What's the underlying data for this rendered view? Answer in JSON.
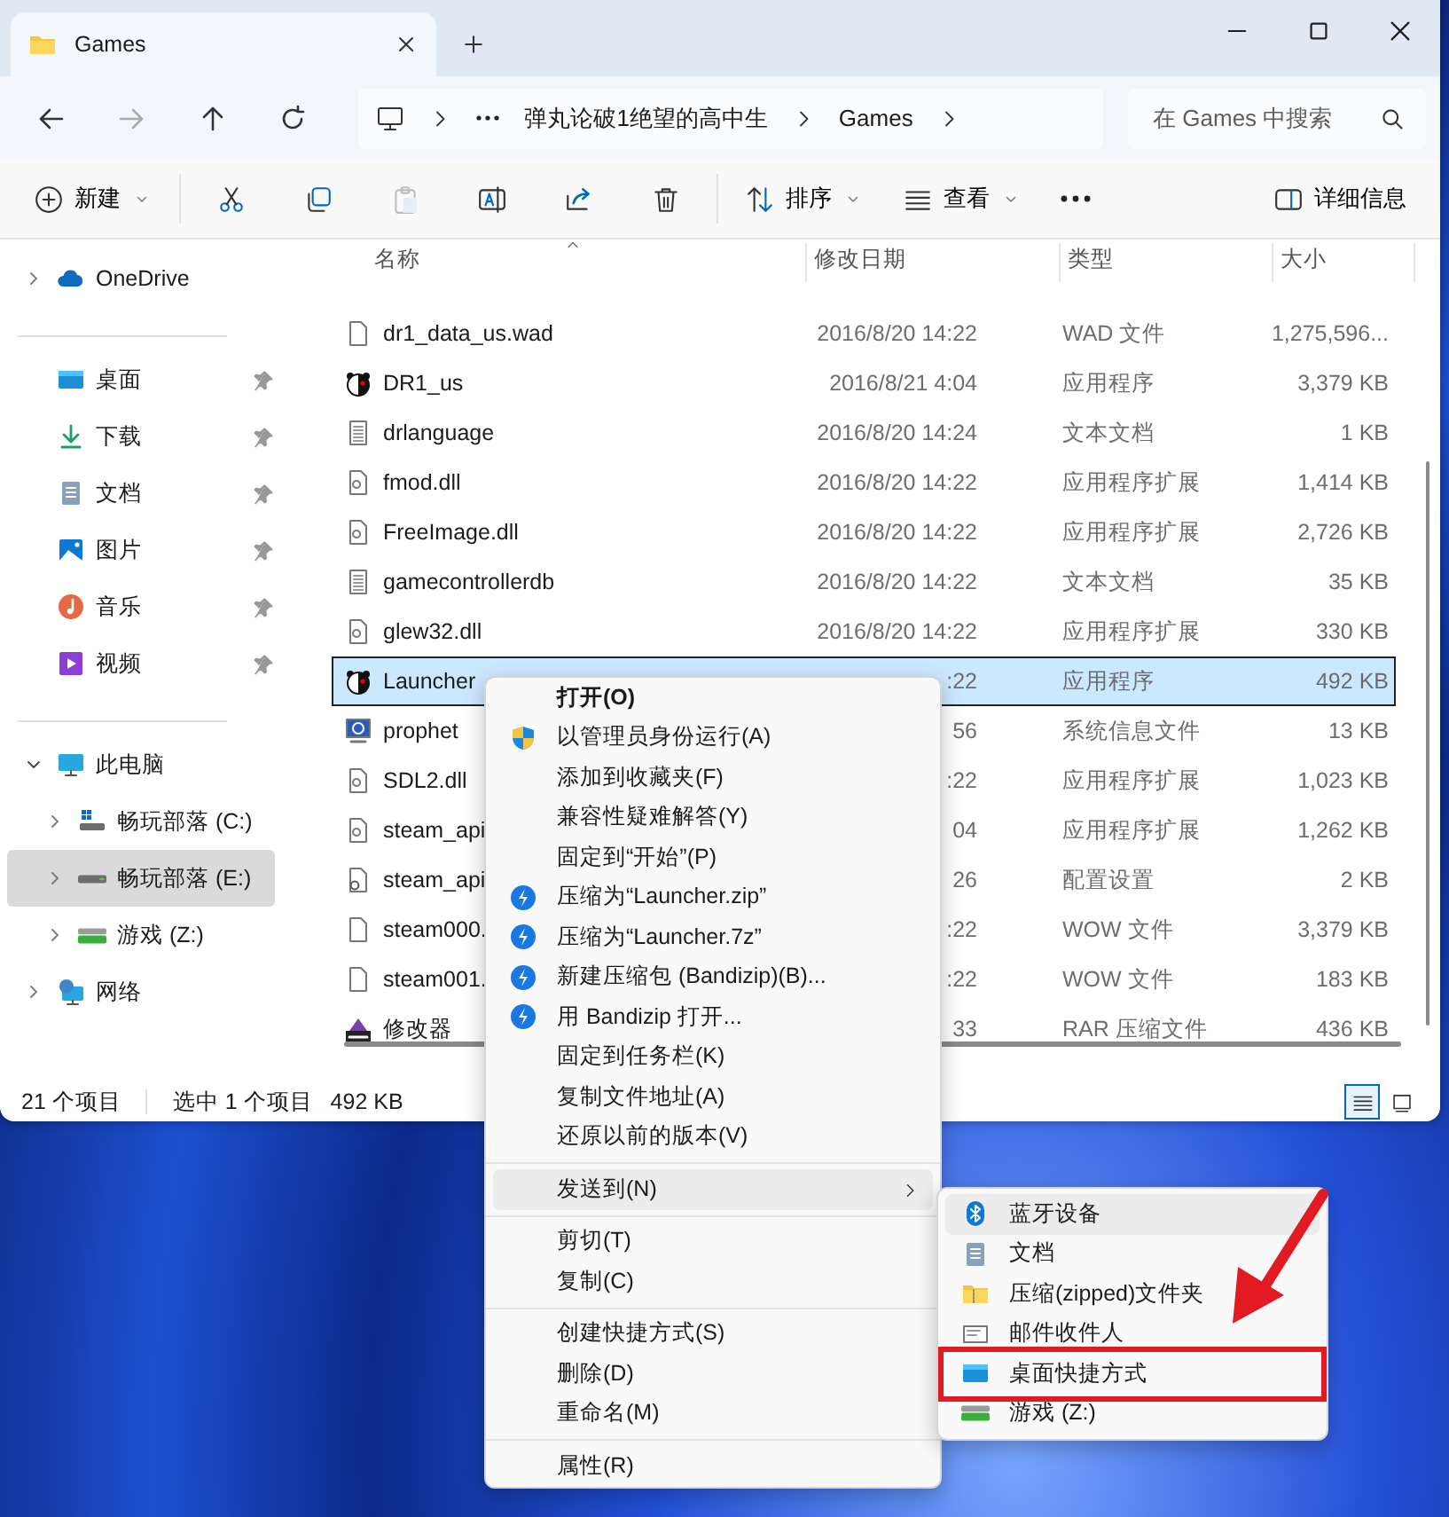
{
  "window": {
    "tab_title": "Games"
  },
  "address": {
    "path": [
      "弹丸论破1绝望的高中生",
      "Games"
    ],
    "search_placeholder": "在 Games 中搜索"
  },
  "toolbar": [
    {
      "kind": "new",
      "label": "新建",
      "disabled": false
    },
    {
      "kind": "cut",
      "disabled": false
    },
    {
      "kind": "copy",
      "disabled": false
    },
    {
      "kind": "paste",
      "disabled": true
    },
    {
      "kind": "rename",
      "disabled": false
    },
    {
      "kind": "share",
      "disabled": false
    },
    {
      "kind": "delete",
      "disabled": false
    },
    {
      "kind": "sort",
      "label": "排序",
      "disabled": false
    },
    {
      "kind": "view",
      "label": "查看",
      "disabled": false
    },
    {
      "kind": "more",
      "disabled": false
    },
    {
      "kind": "details",
      "label": "详细信息",
      "disabled": false
    }
  ],
  "sidebar": {
    "sections": [
      [
        {
          "kind": "cloud",
          "label": "OneDrive",
          "expanded": false,
          "selected": false
        }
      ],
      [
        {
          "kind": "desktop",
          "label": "桌面",
          "pinned": true,
          "selected": false
        },
        {
          "kind": "downloads",
          "label": "下载",
          "pinned": true,
          "selected": false
        },
        {
          "kind": "documents",
          "label": "文档",
          "pinned": true,
          "selected": false
        },
        {
          "kind": "pictures",
          "label": "图片",
          "pinned": true,
          "selected": false
        },
        {
          "kind": "music",
          "label": "音乐",
          "pinned": true,
          "selected": false
        },
        {
          "kind": "videos",
          "label": "视频",
          "pinned": true,
          "selected": false
        }
      ],
      [
        {
          "kind": "computer",
          "label": "此电脑",
          "expanded": true,
          "selected": false,
          "children": [
            {
              "kind": "systemdrive",
              "label": "畅玩部落 (C:)",
              "expanded": false,
              "selected": false
            },
            {
              "kind": "drive",
              "label": "畅玩部落 (E:)",
              "expanded": false,
              "selected": true
            },
            {
              "kind": "netdrive",
              "label": "游戏 (Z:)",
              "expanded": false,
              "selected": false
            }
          ]
        },
        {
          "kind": "network",
          "label": "网络",
          "expanded": false,
          "selected": false
        }
      ]
    ]
  },
  "columns": [
    "名称",
    "修改日期",
    "类型",
    "大小"
  ],
  "files": [
    {
      "kind": "file",
      "name": "dr1_data_us.wad",
      "date": "2016/8/20 14:22",
      "type": "WAD 文件",
      "size": "1,275,596...",
      "selected": false
    },
    {
      "kind": "app",
      "name": "DR1_us",
      "date": "2016/8/21 4:04",
      "type": "应用程序",
      "size": "3,379 KB",
      "selected": false
    },
    {
      "kind": "text",
      "name": "drlanguage",
      "date": "2016/8/20 14:24",
      "type": "文本文档",
      "size": "1 KB",
      "selected": false
    },
    {
      "kind": "library",
      "name": "fmod.dll",
      "date": "2016/8/20 14:22",
      "type": "应用程序扩展",
      "size": "1,414 KB",
      "selected": false
    },
    {
      "kind": "library",
      "name": "FreeImage.dll",
      "date": "2016/8/20 14:22",
      "type": "应用程序扩展",
      "size": "2,726 KB",
      "selected": false
    },
    {
      "kind": "text",
      "name": "gamecontrollerdb",
      "date": "2016/8/20 14:22",
      "type": "文本文档",
      "size": "35 KB",
      "selected": false
    },
    {
      "kind": "library",
      "name": "glew32.dll",
      "date": "2016/8/20 14:22",
      "type": "应用程序扩展",
      "size": "330 KB",
      "selected": false
    },
    {
      "kind": "app",
      "name": "Launcher",
      "date": ":22",
      "type": "应用程序",
      "size": "492 KB",
      "selected": true
    },
    {
      "kind": "sysinfo",
      "name": "prophet",
      "date": "56",
      "type": "系统信息文件",
      "size": "13 KB",
      "selected": false
    },
    {
      "kind": "library",
      "name": "SDL2.dll",
      "date": ":22",
      "type": "应用程序扩展",
      "size": "1,023 KB",
      "selected": false
    },
    {
      "kind": "library",
      "name": "steam_api",
      "date": "04",
      "type": "应用程序扩展",
      "size": "1,262 KB",
      "selected": false
    },
    {
      "kind": "config",
      "name": "steam_api",
      "date": "26",
      "type": "配置设置",
      "size": "2 KB",
      "selected": false
    },
    {
      "kind": "file",
      "name": "steam000.",
      "date": ":22",
      "type": "WOW 文件",
      "size": "3,379 KB",
      "selected": false
    },
    {
      "kind": "file",
      "name": "steam001.",
      "date": ":22",
      "type": "WOW 文件",
      "size": "183 KB",
      "selected": false
    },
    {
      "kind": "archive",
      "name": "修改器",
      "date": "33",
      "type": "RAR 压缩文件",
      "size": "436 KB",
      "selected": false
    }
  ],
  "status_bar": {
    "item_count": "21 个项目",
    "selection": "选中 1 个项目",
    "size": "492 KB",
    "views": [
      {
        "kind": "details",
        "selected": true
      },
      {
        "kind": "tiles",
        "selected": false
      }
    ]
  },
  "context_menu": [
    {
      "kind": "item",
      "label": "打开(O)",
      "default": true,
      "submenu": false,
      "hover": false
    },
    {
      "kind": "admin",
      "label": "以管理员身份运行(A)",
      "default": false,
      "submenu": false,
      "hover": false
    },
    {
      "kind": "item",
      "label": "添加到收藏夹(F)",
      "default": false,
      "submenu": false,
      "hover": false
    },
    {
      "kind": "item",
      "label": "兼容性疑难解答(Y)",
      "default": false,
      "submenu": false,
      "hover": false
    },
    {
      "kind": "item",
      "label": "固定到“开始”(P)",
      "default": false,
      "submenu": false,
      "hover": false
    },
    {
      "kind": "bandizip",
      "label": "压缩为“Launcher.zip”",
      "default": false,
      "submenu": false,
      "hover": false
    },
    {
      "kind": "bandizip",
      "label": "压缩为“Launcher.7z”",
      "default": false,
      "submenu": false,
      "hover": false
    },
    {
      "kind": "bandizip",
      "label": "新建压缩包 (Bandizip)(B)...",
      "default": false,
      "submenu": false,
      "hover": false
    },
    {
      "kind": "bandizip",
      "label": "用 Bandizip 打开...",
      "default": false,
      "submenu": false,
      "hover": false
    },
    {
      "kind": "item",
      "label": "固定到任务栏(K)",
      "default": false,
      "submenu": false,
      "hover": false
    },
    {
      "kind": "item",
      "label": "复制文件地址(A)",
      "default": false,
      "submenu": false,
      "hover": false
    },
    {
      "kind": "item",
      "label": "还原以前的版本(V)",
      "default": false,
      "submenu": false,
      "hover": false
    },
    {
      "kind": "separator"
    },
    {
      "kind": "item",
      "label": "发送到(N)",
      "default": false,
      "submenu": true,
      "hover": true
    },
    {
      "kind": "separator"
    },
    {
      "kind": "item",
      "label": "剪切(T)",
      "default": false,
      "submenu": false,
      "hover": false
    },
    {
      "kind": "item",
      "label": "复制(C)",
      "default": false,
      "submenu": false,
      "hover": false
    },
    {
      "kind": "separator"
    },
    {
      "kind": "item",
      "label": "创建快捷方式(S)",
      "default": false,
      "submenu": false,
      "hover": false
    },
    {
      "kind": "item",
      "label": "删除(D)",
      "default": false,
      "submenu": false,
      "hover": false
    },
    {
      "kind": "item",
      "label": "重命名(M)",
      "default": false,
      "submenu": false,
      "hover": false
    },
    {
      "kind": "separator"
    },
    {
      "kind": "item",
      "label": "属性(R)",
      "default": false,
      "submenu": false,
      "hover": false
    }
  ],
  "send_to_menu": [
    {
      "kind": "bluetooth",
      "label": "蓝牙设备",
      "hover": true,
      "highlighted": false
    },
    {
      "kind": "documents",
      "label": "文档",
      "hover": false,
      "highlighted": false
    },
    {
      "kind": "zip",
      "label": "压缩(zipped)文件夹",
      "hover": false,
      "highlighted": false
    },
    {
      "kind": "mail",
      "label": "邮件收件人",
      "hover": false,
      "highlighted": false
    },
    {
      "kind": "desktop",
      "label": "桌面快捷方式",
      "hover": false,
      "highlighted": true
    },
    {
      "kind": "netdrive",
      "label": "游戏 (Z:)",
      "hover": false,
      "highlighted": false
    }
  ]
}
